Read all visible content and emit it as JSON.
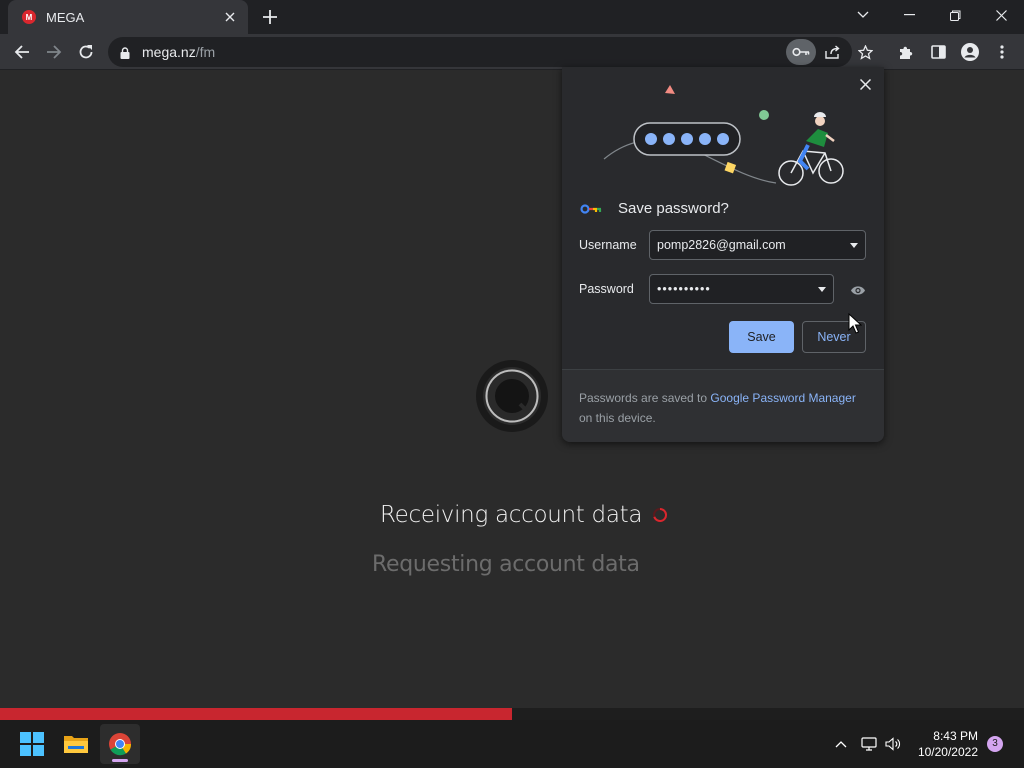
{
  "browser": {
    "tab": {
      "favicon_text": "M",
      "title": "MEGA"
    },
    "address": {
      "host": "mega.nz",
      "path": "/fm"
    }
  },
  "page": {
    "status_main": "Receiving account data",
    "status_sub": "Requesting account data",
    "progress": 0.5,
    "accent_color": "#c8262f"
  },
  "password_bubble": {
    "title": "Save password?",
    "username_label": "Username",
    "username_value": "pomp2826@gmail.com",
    "password_label": "Password",
    "password_value": "••••••••••",
    "save_label": "Save",
    "never_label": "Never",
    "footer_prefix": "Passwords are saved to ",
    "footer_link": "Google Password Manager",
    "footer_suffix": " on this device."
  },
  "taskbar": {
    "time": "8:43 PM",
    "date": "10/20/2022",
    "notification_count": "3",
    "apps": [
      "windows-start-icon",
      "file-explorer-icon",
      "chrome-icon"
    ]
  }
}
